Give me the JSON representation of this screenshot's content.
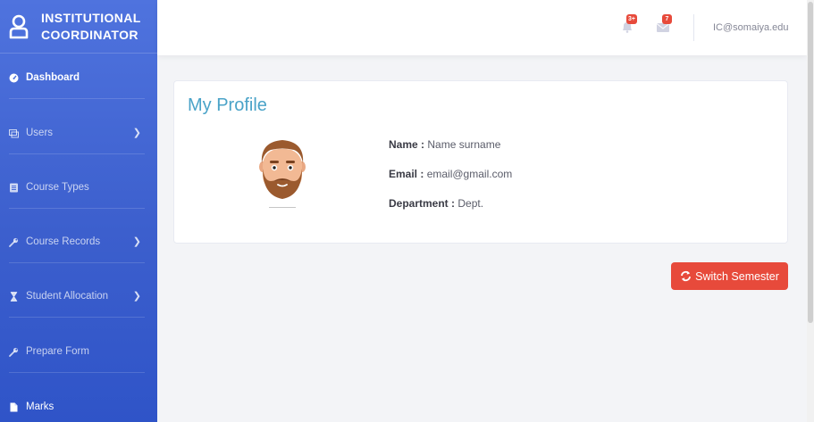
{
  "brand": {
    "line1": "INSTITUTIONAL",
    "line2": "COORDINATOR"
  },
  "sidebar": {
    "items": [
      {
        "label": "Dashboard",
        "icon": "tachometer-icon",
        "active": true
      },
      {
        "label": "Users",
        "icon": "users-icon",
        "chevron": true
      },
      {
        "label": "Course Types",
        "icon": "list-icon"
      },
      {
        "label": "Course Records",
        "icon": "wrench-icon",
        "chevron": true
      },
      {
        "label": "Student Allocation",
        "icon": "hourglass-icon",
        "chevron": true
      },
      {
        "label": "Prepare Form",
        "icon": "wrench-icon"
      },
      {
        "label": "Marks",
        "icon": "file-icon",
        "active": true
      }
    ]
  },
  "topbar": {
    "alerts_badge": "3+",
    "messages_badge": "7",
    "user_email": "IC@somaiya.edu"
  },
  "profile": {
    "title": "My Profile",
    "name_label": "Name :",
    "name_value": "Name surname",
    "email_label": "Email :",
    "email_value": "email@gmail.com",
    "department_label": "Department :",
    "department_value": "Dept."
  },
  "actions": {
    "switch_semester": "Switch Semester"
  },
  "colors": {
    "sidebar": "#4e73df",
    "accent_red": "#e74a3b",
    "title_blue": "#4aa3c8"
  }
}
